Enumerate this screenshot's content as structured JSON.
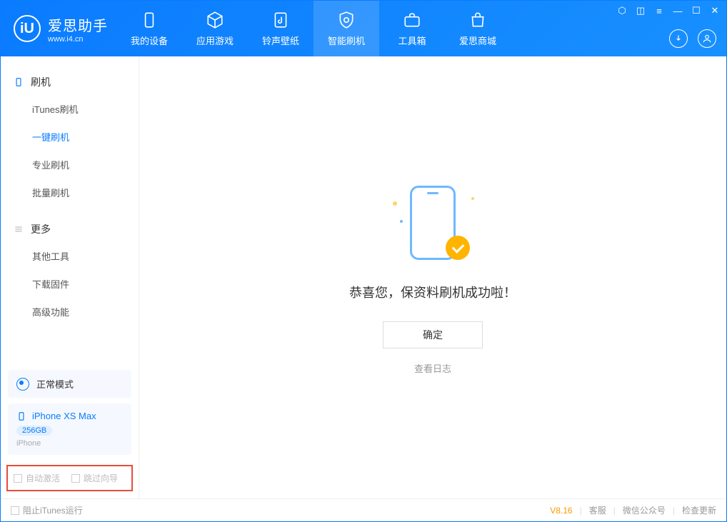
{
  "header": {
    "logo_text": "爱思助手",
    "logo_url": "www.i4.cn",
    "tabs": [
      {
        "label": "我的设备"
      },
      {
        "label": "应用游戏"
      },
      {
        "label": "铃声壁纸"
      },
      {
        "label": "智能刷机"
      },
      {
        "label": "工具箱"
      },
      {
        "label": "爱思商城"
      }
    ]
  },
  "sidebar": {
    "section1_title": "刷机",
    "items1": [
      {
        "label": "iTunes刷机"
      },
      {
        "label": "一键刷机"
      },
      {
        "label": "专业刷机"
      },
      {
        "label": "批量刷机"
      }
    ],
    "section2_title": "更多",
    "items2": [
      {
        "label": "其他工具"
      },
      {
        "label": "下载固件"
      },
      {
        "label": "高级功能"
      }
    ],
    "mode_text": "正常模式",
    "device": {
      "name": "iPhone XS Max",
      "capacity": "256GB",
      "type": "iPhone"
    },
    "checks": [
      {
        "label": "自动激活"
      },
      {
        "label": "跳过向导"
      }
    ]
  },
  "main": {
    "success_text": "恭喜您，保资料刷机成功啦！",
    "ok_button": "确定",
    "view_log": "查看日志"
  },
  "footer": {
    "prevent_itunes": "阻止iTunes运行",
    "version": "V8.16",
    "links": [
      "客服",
      "微信公众号",
      "检查更新"
    ]
  }
}
